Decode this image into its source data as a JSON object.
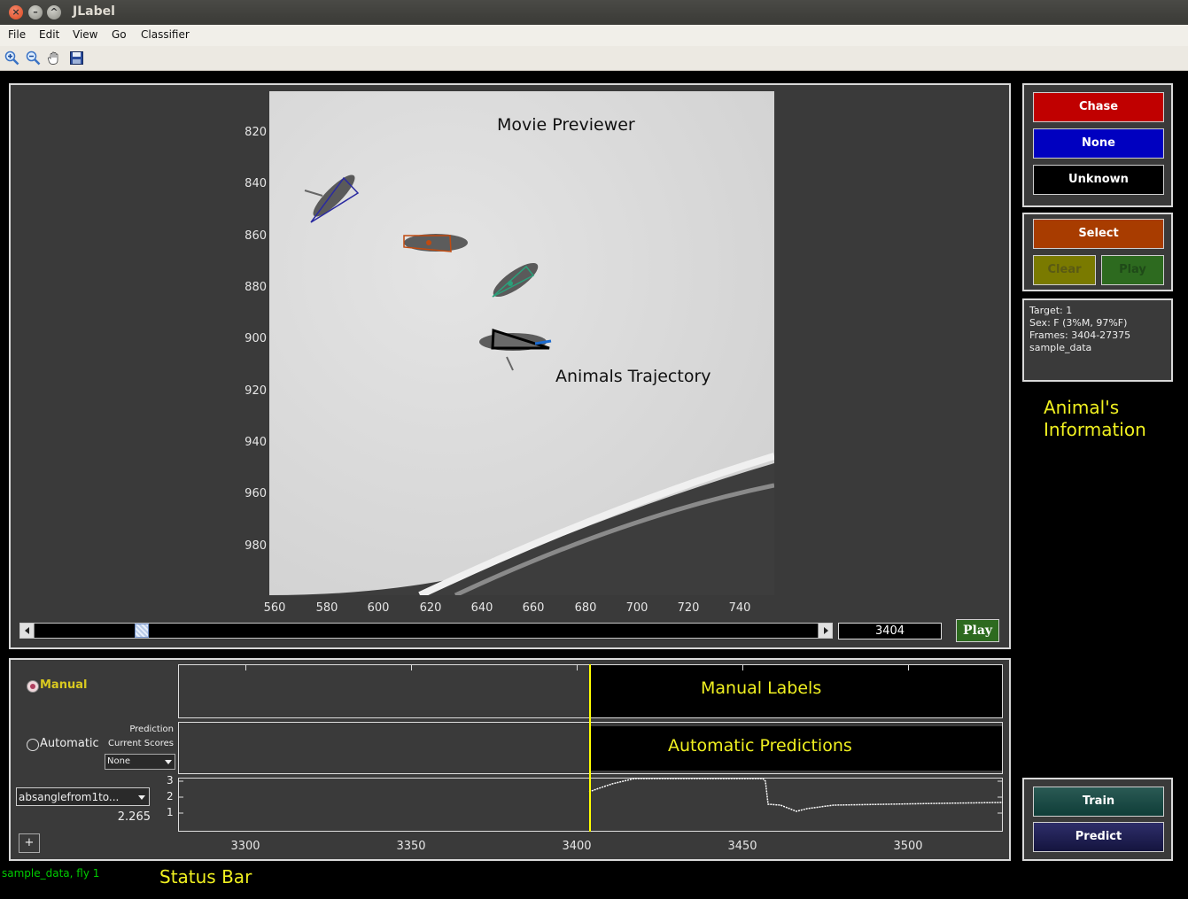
{
  "window": {
    "title": "JLabel"
  },
  "menu": [
    "File",
    "Edit",
    "View",
    "Go",
    "Classifier"
  ],
  "toolbar": {
    "icons": [
      "zoom-in-icon",
      "zoom-out-icon",
      "pan-hand-icon",
      "save-icon"
    ]
  },
  "previewer": {
    "y_ticks": [
      "820",
      "840",
      "860",
      "880",
      "900",
      "920",
      "940",
      "960",
      "980"
    ],
    "x_ticks": [
      "560",
      "580",
      "600",
      "620",
      "640",
      "660",
      "680",
      "700",
      "720",
      "740"
    ],
    "annotation_title": "Movie Previewer",
    "annotation_trajectory": "Animals Trajectory",
    "frame_value": "3404",
    "play_label": "Play",
    "slider_position": 0.13
  },
  "behaviors": {
    "chase": "Chase",
    "none": "None",
    "unknown": "Unknown"
  },
  "selection": {
    "select": "Select",
    "clear": "Clear",
    "play": "Play"
  },
  "info": {
    "target": "Target: 1",
    "sex": "Sex: F (3%M, 97%F)",
    "frames": "Frames: 3404-27375",
    "experiment": "sample_data",
    "annotation_line1": "Animal's",
    "annotation_line2": "Information"
  },
  "timeline": {
    "manual_radio": "Manual",
    "automatic_radio": "Automatic",
    "prediction_label": "Prediction",
    "current_scores_label": "Current Scores",
    "scores_select": "None",
    "feature_select": "absanglefrom1to...",
    "feature_value": "2.265",
    "manual_annotation": "Manual Labels",
    "auto_annotation": "Automatic Predictions",
    "x_ticks": [
      "3300",
      "3350",
      "3400",
      "3450",
      "3500"
    ],
    "y_ticks": [
      "3",
      "2",
      "1"
    ],
    "add_button": "+",
    "current_frame": 3404
  },
  "classifier": {
    "train": "Train",
    "predict": "Predict"
  },
  "status": {
    "text": "sample_data, fly 1",
    "annotation": "Status Bar"
  },
  "colors": {
    "chase": "#c00000",
    "none": "#0000c0",
    "unknown": "#000000",
    "select": "#a83c00",
    "clear": "#7a7a00",
    "play": "#2d6a1f",
    "train": "#0f3d38",
    "predict": "#1a1a50",
    "annotation": "#ffff00",
    "status": "#00cc00"
  }
}
